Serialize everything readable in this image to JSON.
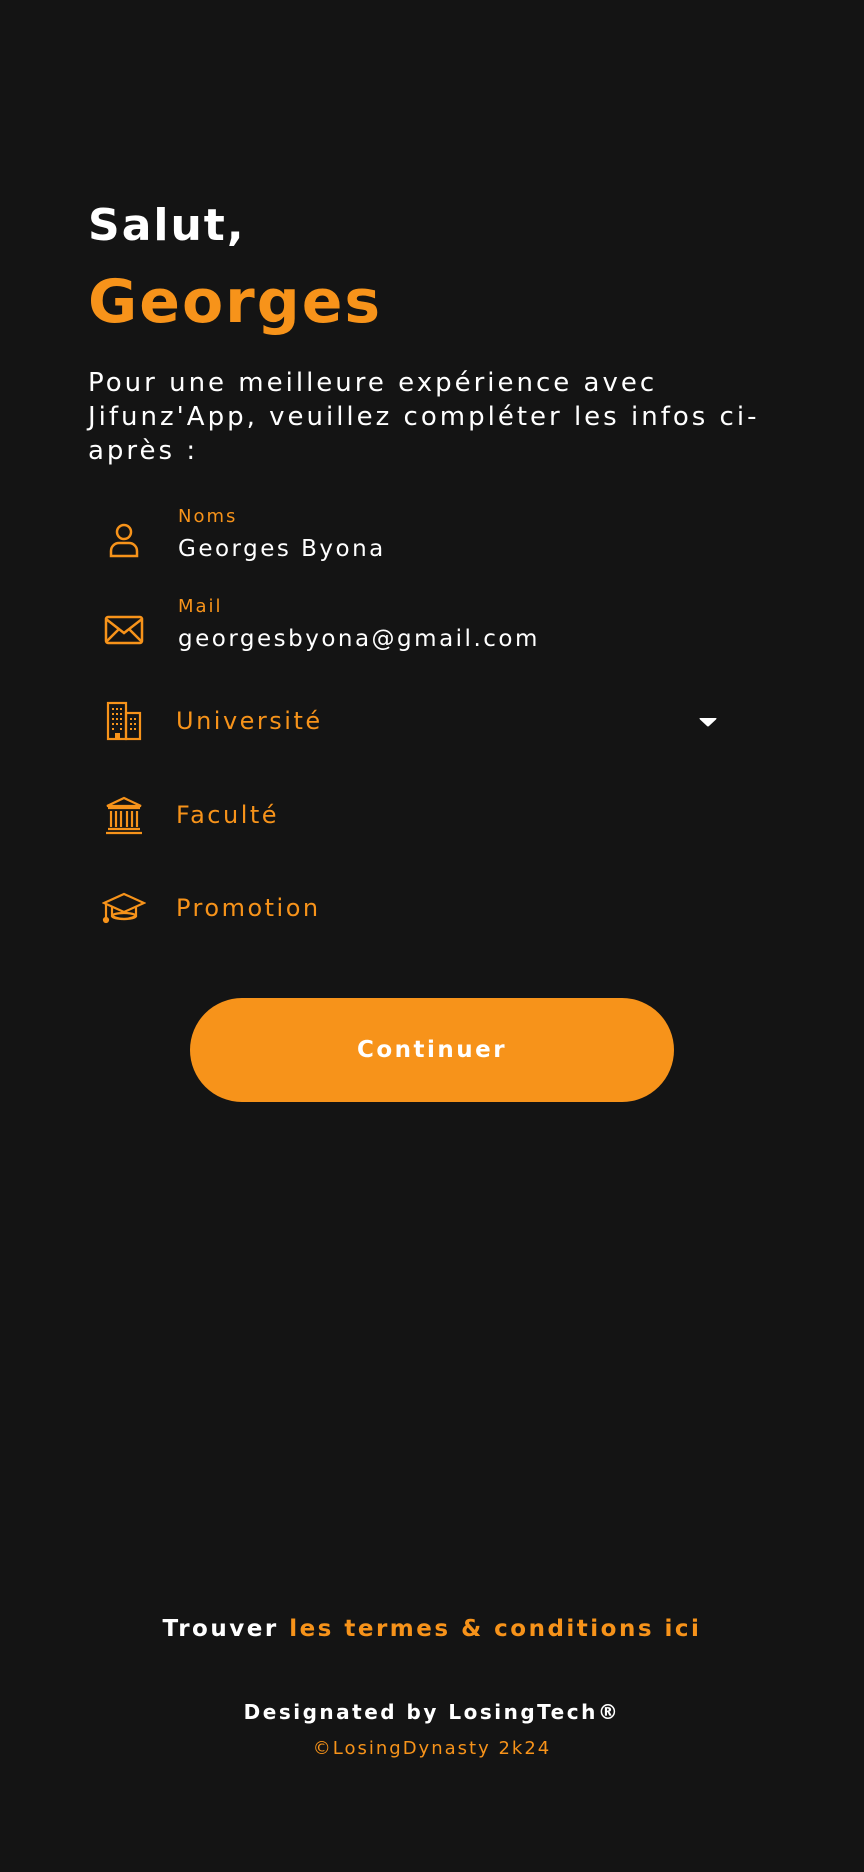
{
  "header": {
    "greeting": "Salut,",
    "user_name": "Georges",
    "intro": "Pour une meilleure expérience avec Jifunz'App, veuillez compléter les infos ci-après :"
  },
  "form": {
    "noms": {
      "label": "Noms",
      "value": "Georges Byona",
      "icon": "user-icon"
    },
    "mail": {
      "label": "Mail",
      "value": "georgesbyona@gmail.com",
      "icon": "envelope-icon"
    },
    "universite": {
      "placeholder": "Université",
      "icon": "building-icon"
    },
    "faculte": {
      "placeholder": "Faculté",
      "icon": "institution-icon"
    },
    "promotion": {
      "placeholder": "Promotion",
      "icon": "graduation-cap-icon"
    }
  },
  "actions": {
    "continue_label": "Continuer"
  },
  "footer": {
    "terms_prefix": "Trouver",
    "terms_link": "les termes & conditions ici",
    "designed_by": "Designated by LosingTech®",
    "copyright": "©LosingDynasty 2k24"
  },
  "colors": {
    "accent": "#f7931a",
    "background": "#141414",
    "text": "#ffffff"
  }
}
